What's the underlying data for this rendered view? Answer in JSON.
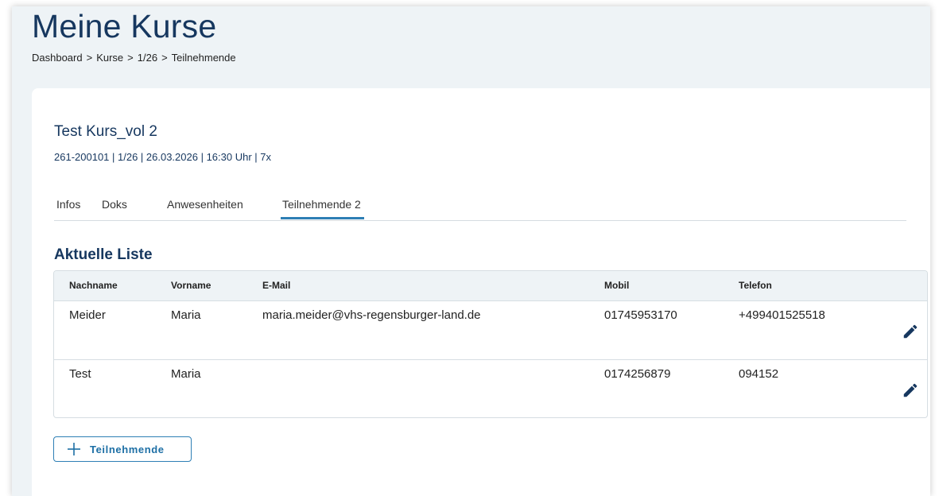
{
  "header": {
    "title": "Meine Kurse",
    "breadcrumb": [
      "Dashboard",
      "Kurse",
      "1/26",
      "Teilnehmende"
    ],
    "separator": ">"
  },
  "course": {
    "title": "Test Kurs_vol 2",
    "meta": "261-200101 | 1/26 | 26.03.2026 | 16:30 Uhr | 7x"
  },
  "tabs": [
    {
      "label": "Infos"
    },
    {
      "label": "Doks"
    },
    {
      "label": "Anwesenheiten"
    },
    {
      "label": "Teilnehmende 2",
      "active": true
    }
  ],
  "list": {
    "title": "Aktuelle Liste",
    "columns": [
      "Nachname",
      "Vorname",
      "E-Mail",
      "Mobil",
      "Telefon"
    ],
    "rows": [
      {
        "nachname": "Meider",
        "vorname": "Maria",
        "email": "maria.meider@vhs-regensburger-land.de",
        "mobil": "01745953170",
        "telefon": "+499401525518"
      },
      {
        "nachname": "Test",
        "vorname": "Maria",
        "email": "",
        "mobil": "0174256879",
        "telefon": "094152"
      }
    ]
  },
  "add_button": {
    "label": "Teilnehmende",
    "icon": "plus-icon"
  },
  "colors": {
    "primary": "#16375f",
    "accent": "#2e7fb5",
    "background": "#eef3f6"
  }
}
